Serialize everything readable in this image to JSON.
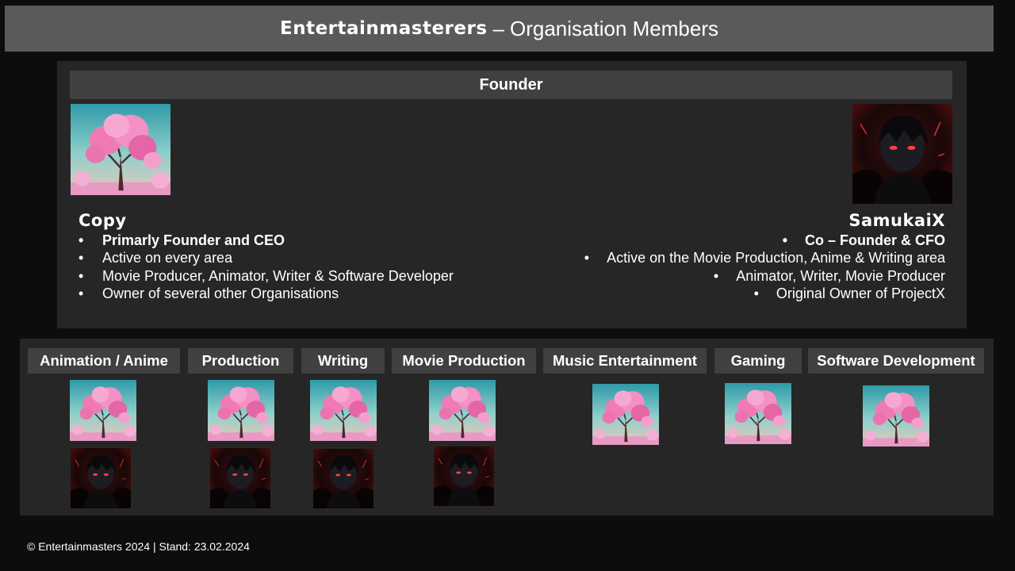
{
  "header": {
    "brand": "Entertainmasterers",
    "dash": "–",
    "title": "Organisation Members"
  },
  "founder_section": {
    "heading": "Founder",
    "members": [
      {
        "name": "Copy",
        "avatar": "cherry-blossom-tree",
        "roles": [
          "Primarly Founder and CEO",
          "Active on every area",
          "Movie Producer, Animator, Writer & Software Developer",
          "Owner of several other Organisations"
        ]
      },
      {
        "name": "SamukaiX",
        "avatar": "dark-anime-character",
        "roles": [
          "Co – Founder & CFO",
          "Active on the Movie Production, Anime & Writing area",
          "Animator, Writer, Movie Producer",
          "Original Owner of ProjectX"
        ]
      }
    ]
  },
  "departments": [
    {
      "label": "Animation / Anime",
      "avatars": [
        "cherry-blossom-tree",
        "dark-anime-character"
      ]
    },
    {
      "label": "Production",
      "avatars": [
        "cherry-blossom-tree",
        "dark-anime-character"
      ]
    },
    {
      "label": "Writing",
      "avatars": [
        "cherry-blossom-tree",
        "dark-anime-character"
      ]
    },
    {
      "label": "Movie Production",
      "avatars": [
        "cherry-blossom-tree",
        "dark-anime-character"
      ]
    },
    {
      "label": "Music Entertainment",
      "avatars": [
        "cherry-blossom-tree"
      ]
    },
    {
      "label": "Gaming",
      "avatars": [
        "cherry-blossom-tree"
      ]
    },
    {
      "label": "Software Development",
      "avatars": [
        "cherry-blossom-tree"
      ]
    }
  ],
  "bullet": "•",
  "footer": {
    "text": "© Entertainmasters 2024 | Stand: 23.02.2024"
  },
  "colors": {
    "page_background": "#0d0d0d",
    "title_bar": "#5a5a5a",
    "panel": "#262626",
    "header_chip": "#404040",
    "text": "#ffffff"
  }
}
